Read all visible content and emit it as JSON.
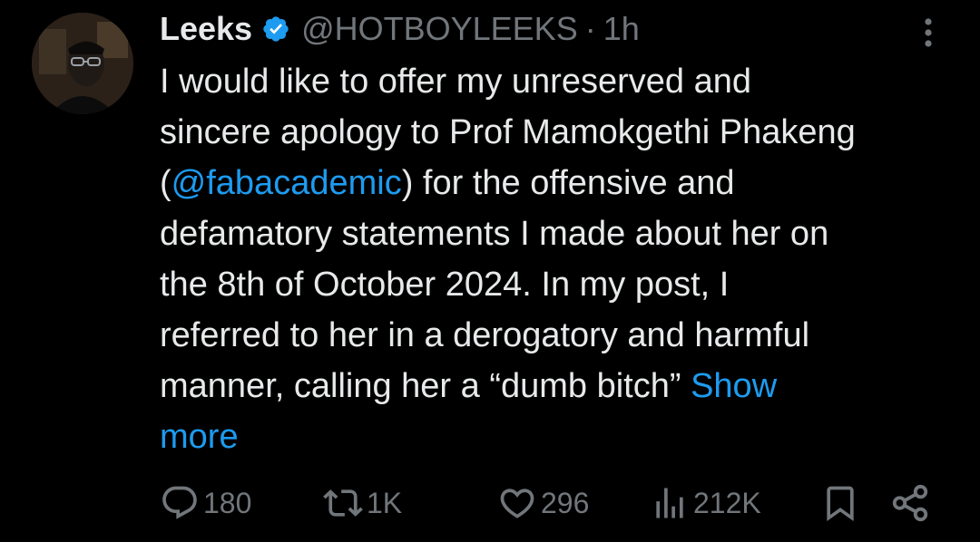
{
  "tweet": {
    "author": {
      "name": "Leeks",
      "handle": "@HOTBOYLEEKS",
      "verified": true
    },
    "separator": "·",
    "time": "1h",
    "text": {
      "l1": "I would like to offer my unreserved and",
      "l2": "sincere apology to Prof Mamokgethi Phakeng",
      "l3_open": "(",
      "l3_mention": "@fabacademic",
      "l3_rest": ") for the offensive and",
      "l4": "defamatory statements I made about her on",
      "l5": "the 8th of October 2024. In my post, I",
      "l6": "referred to her in a derogatory and harmful",
      "l7": "manner, calling her a “dumb bitch” ",
      "show_more_1": "Show",
      "show_more_2": "more"
    },
    "stats": {
      "replies": "180",
      "reposts": "1K",
      "likes": "296",
      "views": "212K"
    }
  },
  "colors": {
    "background": "#000000",
    "text": "#e7e9ea",
    "secondary": "#71767b",
    "link": "#1d9bf0",
    "verified": "#1d9bf0"
  }
}
